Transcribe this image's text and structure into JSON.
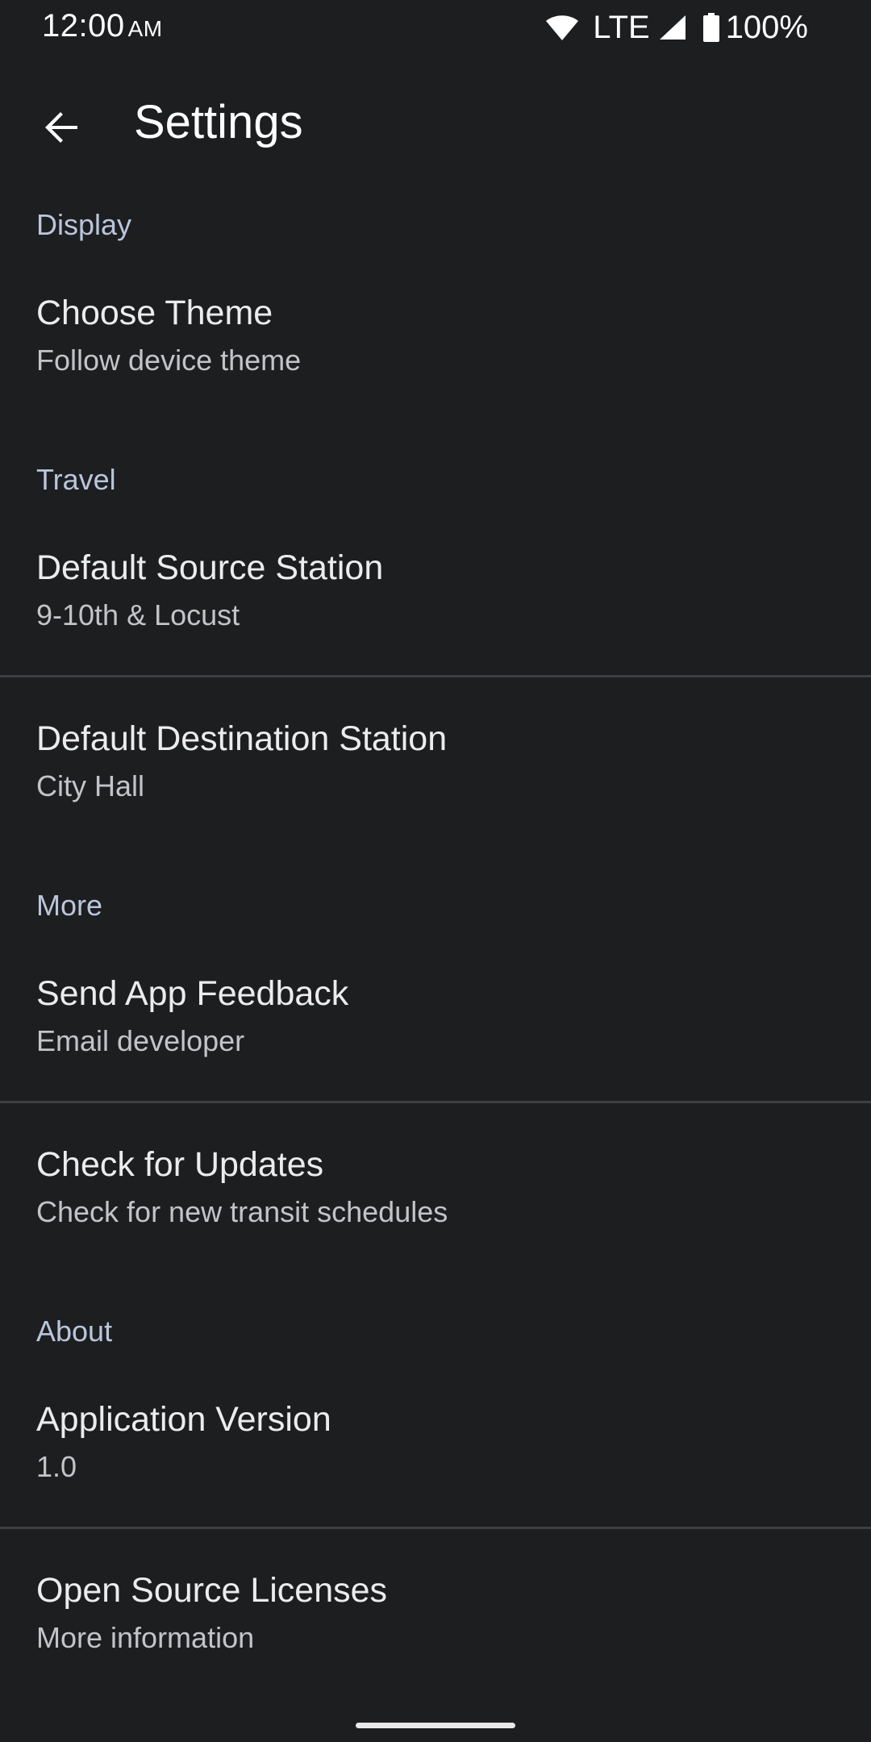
{
  "status_bar": {
    "time": "12:00",
    "ampm": "AM",
    "network": "LTE",
    "battery": "100%"
  },
  "app_bar": {
    "title": "Settings",
    "back_icon": "arrow-back-icon"
  },
  "sections": {
    "display": {
      "header": "Display",
      "items": [
        {
          "title": "Choose Theme",
          "summary": "Follow device theme"
        }
      ]
    },
    "travel": {
      "header": "Travel",
      "items": [
        {
          "title": "Default Source Station",
          "summary": "9-10th & Locust"
        },
        {
          "title": "Default Destination Station",
          "summary": "City Hall"
        }
      ]
    },
    "more": {
      "header": "More",
      "items": [
        {
          "title": "Send App Feedback",
          "summary": "Email developer"
        },
        {
          "title": "Check for Updates",
          "summary": "Check for new transit schedules"
        }
      ]
    },
    "about": {
      "header": "About",
      "items": [
        {
          "title": "Application Version",
          "summary": "1.0"
        },
        {
          "title": "Open Source Licenses",
          "summary": "More information"
        }
      ]
    }
  },
  "colors": {
    "background": "#1d1e20",
    "section_header": "#b9c6dc",
    "title_text": "#ececee",
    "summary_text": "#c3c4c8",
    "divider": "#3e3f42"
  }
}
